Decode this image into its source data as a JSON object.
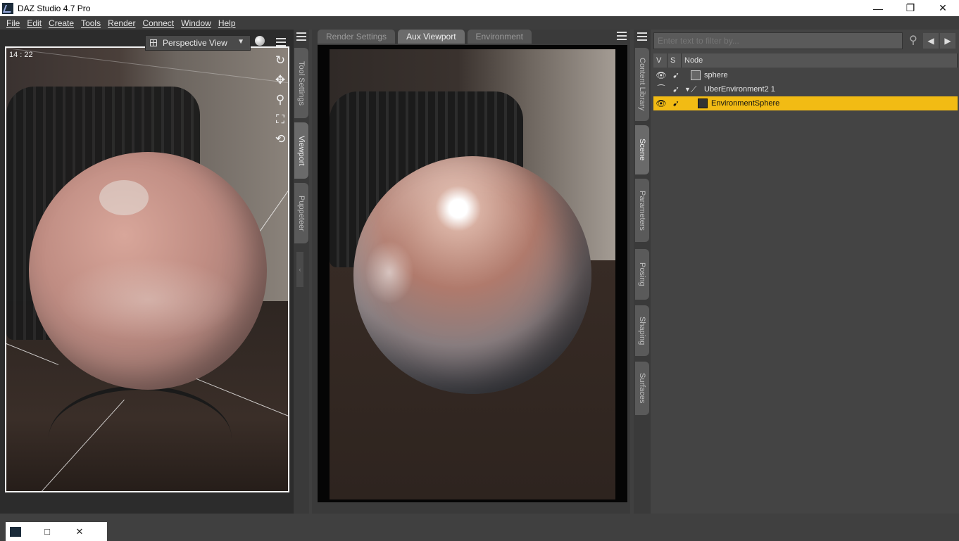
{
  "window": {
    "title": "DAZ Studio 4.7 Pro",
    "controls": {
      "minimize": "—",
      "restore": "❐",
      "close": "✕"
    }
  },
  "menu": [
    "File",
    "Edit",
    "Create",
    "Tools",
    "Render",
    "Connect",
    "Window",
    "Help"
  ],
  "left_viewport": {
    "timecode": "14 : 22",
    "view_dropdown": "Perspective View",
    "nav_tools": [
      "orbit-icon",
      "pan-icon",
      "zoom-icon",
      "frame-icon",
      "reset-icon"
    ],
    "tabs": [
      "Tool Settings",
      "Viewport",
      "Puppeteer"
    ],
    "active_tab": "Viewport"
  },
  "center": {
    "tabs": [
      "Render Settings",
      "Aux Viewport",
      "Environment"
    ],
    "active_tab": "Aux Viewport"
  },
  "right_tabs": [
    "Content Library",
    "Scene",
    "Parameters",
    "Posing",
    "Shaping",
    "Surfaces"
  ],
  "right_active_tab": "Scene",
  "scene": {
    "filter_placeholder": "Enter text to filter by...",
    "columns": [
      "V",
      "S",
      "Node"
    ],
    "nodes": [
      {
        "label": "sphere",
        "selected": false,
        "expanded": null
      },
      {
        "label": "UberEnvironment2 1",
        "selected": false,
        "expanded": true
      },
      {
        "label": "EnvironmentSphere",
        "selected": true,
        "expanded": null
      }
    ]
  },
  "floating_window": {
    "controls": [
      "□",
      "✕"
    ]
  },
  "colors": {
    "selection": "#f2bb14",
    "panel_bg": "#444444",
    "menu_bg": "#3d3d3d"
  }
}
